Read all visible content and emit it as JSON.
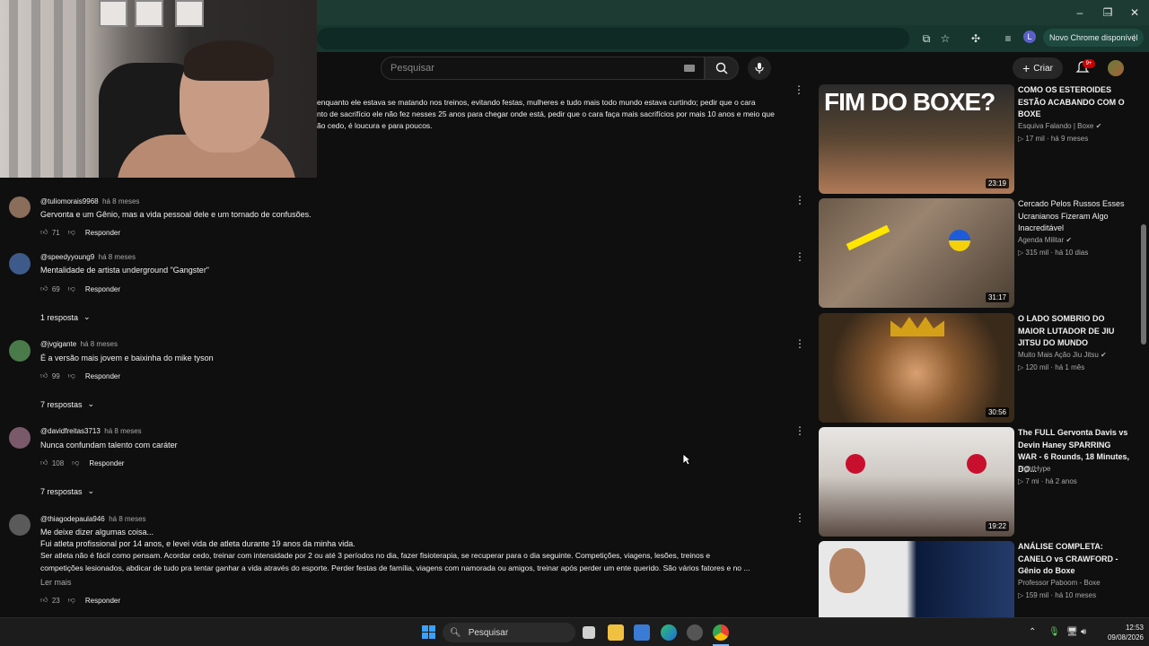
{
  "browser": {
    "update_label": "Novo Chrome disponível",
    "profile_initial": "L"
  },
  "header": {
    "search_placeholder": "Pesquisar",
    "create_label": "Criar",
    "notifications_badge": "9+"
  },
  "top_comment": {
    "text_lines": [
      "enquanto ele estava se matando nos treinos, evitando festas, mulheres e tudo mais todo mundo estava curtindo; pedir que o cara",
      "nto de sacrifício ele não fez nesses 25 anos para chegar onde está, pedir que o cara faça mais sacrifícios por mais 10 anos e meio que",
      "ão cedo, é loucura e para poucos."
    ]
  },
  "comments": [
    {
      "author": "@tuliomorais9968",
      "time": "há 8 meses",
      "text": [
        "Gervonta e um Gênio, mas a vida pessoal dele e um tornado de confusões."
      ],
      "likes": "71",
      "reply_label": "Responder",
      "avatar_color": "#8a6d5a"
    },
    {
      "author": "@speedyyoung9",
      "time": "há 8 meses",
      "text": [
        "Mentalidade de artista underground \"Gangster\""
      ],
      "likes": "69",
      "reply_label": "Responder",
      "replies": "1 resposta",
      "avatar_color": "#3d5a8a"
    },
    {
      "author": "@jvgigante",
      "time": "há 8 meses",
      "text": [
        "É a versão mais jovem e baixinha do mike tyson"
      ],
      "likes": "99",
      "reply_label": "Responder",
      "replies": "7 respostas",
      "avatar_color": "#4a7a4a"
    },
    {
      "author": "@davidfreitas3713",
      "time": "há 8 meses",
      "text": [
        "Nunca confundam talento com caráter"
      ],
      "likes": "108",
      "reply_label": "Responder",
      "replies": "7 respostas",
      "avatar_color": "#7a5a6a"
    },
    {
      "author": "@thiagodepaula946",
      "time": "há 8 meses",
      "text": [
        "Me deixe dizer algumas coisa...",
        "Fui atleta profissional por 14 anos, e levei vida de atleta durante 19 anos da minha vida.",
        "Ser atleta não é fácil como pensam. Acordar cedo, treinar com intensidade por 2 ou até 3 períodos no dia, fazer fisioterapia, se recuperar para o dia seguinte. Competições, viagens, lesões, treinos e",
        "competições lesionados, abdicar de tudo pra tentar ganhar a vida através do esporte. Perder festas de família, viagens com namorada ou amigos, treinar após perder um ente querido. São vários fatores e no ..."
      ],
      "read_more": "Ler mais",
      "likes": "23",
      "reply_label": "Responder",
      "avatar_color": "#5a5a5a"
    }
  ],
  "videos": [
    {
      "title": "COMO OS ESTEROIDES ESTÃO ACABANDO COM O BOXE",
      "channel": "Esquiva Falando | Boxe",
      "verified": true,
      "views": "17 mil",
      "age": "há 9 meses",
      "duration": "23:19",
      "thumb_text": "FIM DO BOXE?"
    },
    {
      "title": "Cercado Pelos Russos Esses Ucranianos Fizeram Algo Inacreditável",
      "channel": "Agenda Militar",
      "verified": true,
      "views": "315 mil",
      "age": "há 10 dias",
      "duration": "31:17"
    },
    {
      "title": "O LADO SOMBRIO DO MAIOR LUTADOR DE JIU JITSU DO MUNDO",
      "channel": "Muito Mais Ação Jiu Jitsu",
      "verified": true,
      "views": "120 mil",
      "age": "há 1 mês",
      "duration": "30:56"
    },
    {
      "title": "The FULL Gervonta Davis vs Devin Haney SPARRING WAR - 6 Rounds, 18 Minutes, DO...",
      "channel": "FightHype",
      "verified": false,
      "views": "7 mi",
      "age": "há 2 anos",
      "duration": "19:22"
    },
    {
      "title": "ANÁLISE COMPLETA: CANELO vs CRAWFORD - Gênio do Boxe",
      "channel": "Professor Paboom - Boxe",
      "verified": false,
      "views": "159 mil",
      "age": "há 10 meses",
      "duration": ""
    }
  ],
  "taskbar": {
    "search_label": "Pesquisar",
    "time": "12:53",
    "date": "09/08/2026"
  }
}
